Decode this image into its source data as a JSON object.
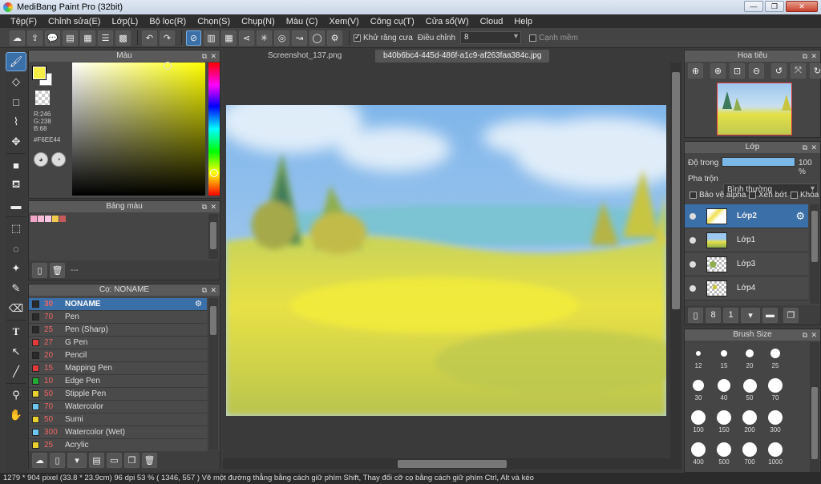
{
  "window": {
    "title": "MediBang Paint Pro (32bit)",
    "buttons": {
      "minimize": "—",
      "maximize": "❐",
      "close": "✕"
    }
  },
  "menu": [
    "Tệp(F)",
    "Chỉnh sửa(E)",
    "Lớp(L)",
    "Bộ lọc(R)",
    "Chọn(S)",
    "Chụp(N)",
    "Màu (C)",
    "Xem(V)",
    "Công cụ(T)",
    "Cửa sổ(W)",
    "Cloud",
    "Help"
  ],
  "toolbar": {
    "antialias_label": "Khử răng cưa",
    "adjust_label": "Điều chỉnh",
    "adjust_value": "8",
    "smooth_label": "Cạnh mềm"
  },
  "color_panel": {
    "title": "Màu",
    "r": "R:246",
    "g": "G:238",
    "b": "B:68",
    "hex": "#F6EE44",
    "fg_color": "#F6EE44"
  },
  "palette_panel": {
    "title": "Bảng màu",
    "swatches": [
      "#f4a6c8",
      "#f8b9d4",
      "#f7c6e0",
      "#f2c94c",
      "#c65a5a"
    ],
    "footer_text": "---"
  },
  "brush_panel": {
    "title": "Cọ: NONAME",
    "brushes": [
      {
        "size": "30",
        "name": "NONAME",
        "color": "#2a2a2a",
        "selected": true
      },
      {
        "size": "70",
        "name": "Pen",
        "color": "#2a2a2a"
      },
      {
        "size": "25",
        "name": "Pen (Sharp)",
        "color": "#2a2a2a"
      },
      {
        "size": "27",
        "name": "G Pen",
        "color": "#e03a3a"
      },
      {
        "size": "20",
        "name": "Pencil",
        "color": "#2a2a2a"
      },
      {
        "size": "15",
        "name": "Mapping Pen",
        "color": "#e03a3a"
      },
      {
        "size": "10",
        "name": "Edge Pen",
        "color": "#22aa33"
      },
      {
        "size": "50",
        "name": "Stipple Pen",
        "color": "#e8d030"
      },
      {
        "size": "70",
        "name": "Watercolor",
        "color": "#6ec6f0"
      },
      {
        "size": "50",
        "name": "Sumi",
        "color": "#e8d030"
      },
      {
        "size": "300",
        "name": "Watercolor (Wet)",
        "color": "#6ec6f0"
      },
      {
        "size": "25",
        "name": "Acrylic",
        "color": "#e8d030"
      }
    ]
  },
  "tabs": [
    {
      "label": "Screenshot_137.png",
      "active": false
    },
    {
      "label": "b40b6bc4-445d-486f-a1c9-af263faa384c.jpg",
      "active": true
    }
  ],
  "navigator": {
    "title": "Hoa tiêu"
  },
  "layers": {
    "title": "Lớp",
    "opacity_label": "Độ trong",
    "opacity_value": "100 %",
    "blend_label": "Pha trộn",
    "blend_value": "Bình thường",
    "protect_alpha": "Bảo vệ alpha",
    "clip": "Xén bớt",
    "lock": "Khóa",
    "items": [
      {
        "name": "Lớp2",
        "selected": true
      },
      {
        "name": "Lớp1",
        "selected": false
      },
      {
        "name": "Lớp3",
        "selected": false
      },
      {
        "name": "Lớp4",
        "selected": false
      }
    ]
  },
  "brush_size": {
    "title": "Brush Size",
    "sizes": [
      "12",
      "15",
      "20",
      "25",
      "30",
      "40",
      "50",
      "70",
      "100",
      "150",
      "200",
      "300",
      "400",
      "500",
      "700",
      "1000"
    ]
  },
  "status": {
    "text": "1279 * 904 pixel   (33.8 * 23.9cm)   96 dpi   53 %   ( 1346, 557 )   Vẽ một đường thẳng bằng cách giữ phím Shift, Thay đổi cỡ cọ bằng cách giữ phím Ctrl, Alt và kéo"
  }
}
